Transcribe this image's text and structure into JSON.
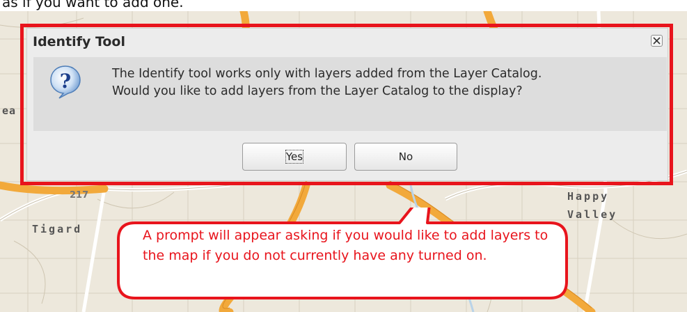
{
  "background_text": "as if you want to add one.",
  "map": {
    "labels": {
      "city_left": "Tigard",
      "city_right_line1": "Happy",
      "city_right_line2": "Valley",
      "partial_left": "ea",
      "route_shield": "217"
    }
  },
  "dialog": {
    "title": "Identify Tool",
    "message_line1": "The Identify tool works only with layers added from the Layer Catalog.",
    "message_line2": "Would you like to add layers from the Layer Catalog to the display?",
    "yes_label": "Yes",
    "no_label": "No",
    "icon": "question-icon",
    "close_icon": "close-icon"
  },
  "annotation": {
    "text": "A prompt will appear asking if you would like to add layers to the map if you do not currently have any turned on.",
    "color": "#e8141c"
  },
  "colors": {
    "highlight": "#e8141c",
    "highway": "#f2a93b",
    "dialog_bg": "#ececec"
  }
}
